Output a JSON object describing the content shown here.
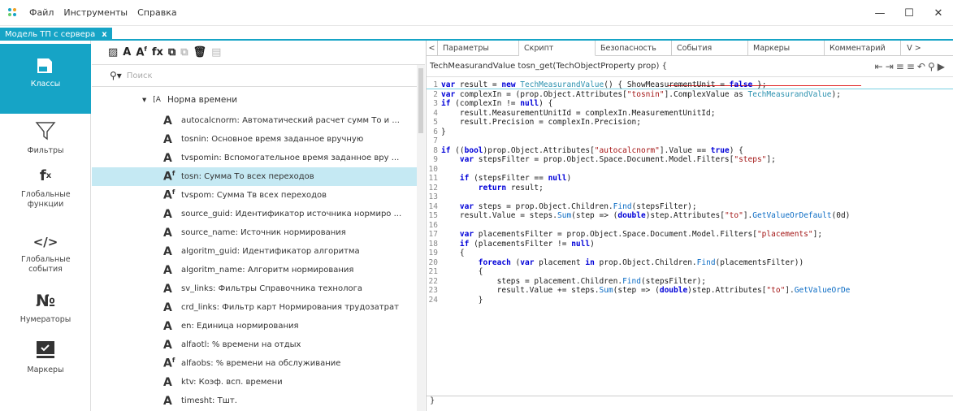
{
  "menubar": {
    "items": [
      "Файл",
      "Инструменты",
      "Справка"
    ]
  },
  "window_controls": {
    "minimize": "—",
    "maximize": "☐",
    "close": "✕"
  },
  "doc_tab": {
    "label": "Модель ТП с сервера",
    "close": "x"
  },
  "nav": [
    {
      "label": "Классы",
      "icon": "classes-icon"
    },
    {
      "label": "Фильтры",
      "icon": "filter-icon"
    },
    {
      "label": "Глобальные функции",
      "icon": "function-icon"
    },
    {
      "label": "Глобальные события",
      "icon": "code-icon"
    },
    {
      "label": "Нумераторы",
      "icon": "number-icon"
    },
    {
      "label": "Маркеры",
      "icon": "markers-icon"
    }
  ],
  "search": {
    "placeholder": "Поиск"
  },
  "tree": {
    "root": "Норма времени",
    "items": [
      {
        "icon": "A",
        "label": "autocalcnorm: Автоматический расчет сумм То и ...",
        "more": true
      },
      {
        "icon": "A",
        "label": "tosnin: Основное время заданное вручную"
      },
      {
        "icon": "A",
        "label": "tvspomin: Вспомогательное время заданное вру ...",
        "more": true
      },
      {
        "icon": "Af",
        "label": "tosn: Сумма То всех переходов",
        "selected": true
      },
      {
        "icon": "Af",
        "label": "tvspom: Сумма Тв всех переходов"
      },
      {
        "icon": "A",
        "label": "source_guid: Идентификатор источника нормиро ...",
        "more": true
      },
      {
        "icon": "A",
        "label": "source_name: Источник нормирования"
      },
      {
        "icon": "A",
        "label": "algoritm_guid: Идентификатор алгоритма"
      },
      {
        "icon": "A",
        "label": "algoritm_name: Алгоритм нормирования"
      },
      {
        "icon": "A",
        "label": "sv_links: Фильтры Справочника технолога"
      },
      {
        "icon": "A",
        "label": "crd_links: Фильтр карт Нормирования трудозатрат"
      },
      {
        "icon": "A",
        "label": "en: Единица нормирования"
      },
      {
        "icon": "A",
        "label": "alfaotl: % времени на отдых"
      },
      {
        "icon": "Af",
        "label": "alfaobs: % времени на обслуживание"
      },
      {
        "icon": "A",
        "label": "ktv: Коэф. всп. времени"
      },
      {
        "icon": "A",
        "label": "timesht: Тшт."
      },
      {
        "icon": "A",
        "label": "timepz: Тпз."
      }
    ]
  },
  "right_tabs": [
    "Параметры",
    "Скрипт",
    "Безопасность",
    "События",
    "Маркеры",
    "Комментарий"
  ],
  "signature": "TechMeasurandValue tosn_get(TechObjectProperty prop) {",
  "code": [
    {
      "n": "1",
      "t": "var result = new TechMeasurandValue() { ShowMeasurementUnit = false };"
    },
    {
      "n": "2",
      "t": "var complexIn = (prop.Object.Attributes[\"tosnin\"].ComplexValue as TechMeasurandValue);"
    },
    {
      "n": "3",
      "t": "if (complexIn != null) {"
    },
    {
      "n": "4",
      "t": "    result.MeasurementUnitId = complexIn.MeasurementUnitId;"
    },
    {
      "n": "5",
      "t": "    result.Precision = complexIn.Precision;"
    },
    {
      "n": "6",
      "t": "}"
    },
    {
      "n": "7",
      "t": ""
    },
    {
      "n": "8",
      "t": "if ((bool)prop.Object.Attributes[\"autocalcnorm\"].Value == true) {"
    },
    {
      "n": "9",
      "t": "    var stepsFilter = prop.Object.Space.Document.Model.Filters[\"steps\"];"
    },
    {
      "n": "10",
      "t": ""
    },
    {
      "n": "11",
      "t": "    if (stepsFilter == null)"
    },
    {
      "n": "12",
      "t": "        return result;"
    },
    {
      "n": "13",
      "t": ""
    },
    {
      "n": "14",
      "t": "    var steps = prop.Object.Children.Find(stepsFilter);"
    },
    {
      "n": "15",
      "t": "    result.Value = steps.Sum(step => (double)step.Attributes[\"to\"].GetValueOrDefault(0d)"
    },
    {
      "n": "16",
      "t": ""
    },
    {
      "n": "17",
      "t": "    var placementsFilter = prop.Object.Space.Document.Model.Filters[\"placements\"];"
    },
    {
      "n": "18",
      "t": "    if (placementsFilter != null)"
    },
    {
      "n": "19",
      "t": "    {"
    },
    {
      "n": "20",
      "t": "        foreach (var placement in prop.Object.Children.Find(placementsFilter))"
    },
    {
      "n": "21",
      "t": "        {"
    },
    {
      "n": "22",
      "t": "            steps = placement.Children.Find(stepsFilter);"
    },
    {
      "n": "23",
      "t": "            result.Value += steps.Sum(step => (double)step.Attributes[\"to\"].GetValueOrDe"
    },
    {
      "n": "24",
      "t": "        }"
    }
  ],
  "bottom": "}"
}
